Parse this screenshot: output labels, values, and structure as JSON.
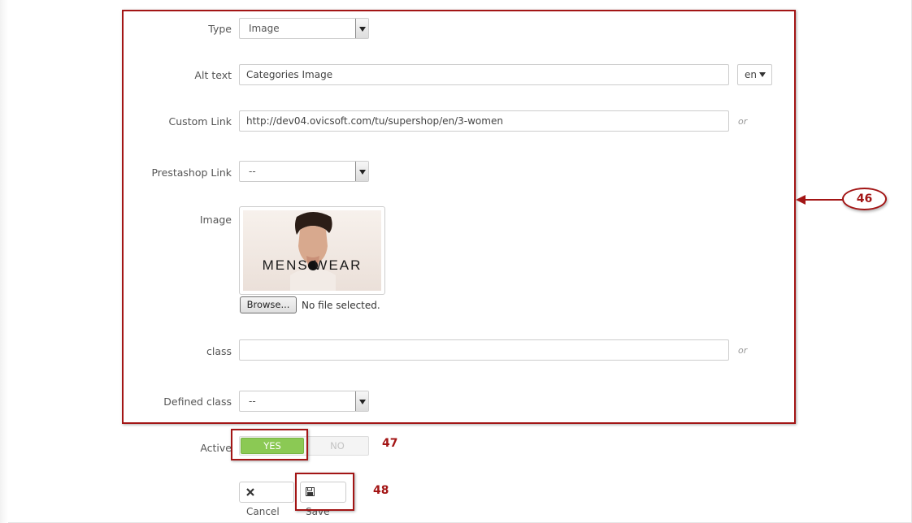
{
  "form": {
    "type": {
      "label": "Type",
      "value": "Image"
    },
    "alt_text": {
      "label": "Alt text",
      "value": "Categories Image",
      "lang": "en"
    },
    "custom_link": {
      "label": "Custom Link",
      "value": "http://dev04.ovicsoft.com/tu/supershop/en/3-women",
      "or": "or"
    },
    "prestashop_link": {
      "label": "Prestashop Link",
      "value": "--"
    },
    "image": {
      "label": "Image",
      "preview_text": "MENS  WEAR",
      "browse_label": "Browse...",
      "file_status": "No file selected."
    },
    "class_field": {
      "label": "class",
      "value": "",
      "or": "or"
    },
    "defined_class": {
      "label": "Defined class",
      "value": "--"
    },
    "active": {
      "label": "Active",
      "yes": "YES",
      "no": "NO",
      "selected": "YES"
    }
  },
  "actions": {
    "cancel": "Cancel",
    "save": "Save"
  },
  "annotations": {
    "a46": "46",
    "a47": "47",
    "a48": "48"
  },
  "colors": {
    "annotation": "#a31515",
    "toggle_on": "#8bc954"
  },
  "icons": {
    "cancel": "times-icon",
    "save": "floppy-disk-icon"
  }
}
